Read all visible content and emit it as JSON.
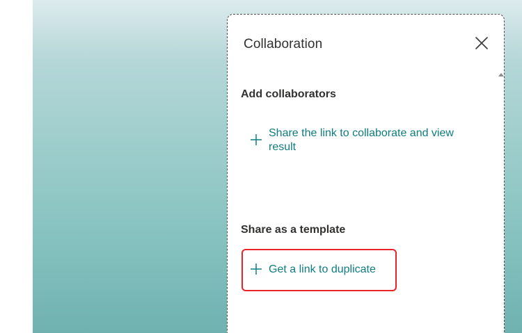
{
  "panel": {
    "title": "Collaboration",
    "close_icon": "close-icon",
    "scroll_icon": "scroll-up-arrow-icon"
  },
  "add_collaborators": {
    "heading": "Add collaborators",
    "link_label": "Share the link to collaborate and view result",
    "icon": "plus-icon"
  },
  "share_template": {
    "heading": "Share as a template",
    "link_label": "Get a link to duplicate",
    "icon": "plus-icon"
  },
  "colors": {
    "accent": "#0f7c80",
    "highlight": "#e8232a",
    "background_top": "#dcebed",
    "background_bottom": "#6fb2b0"
  }
}
